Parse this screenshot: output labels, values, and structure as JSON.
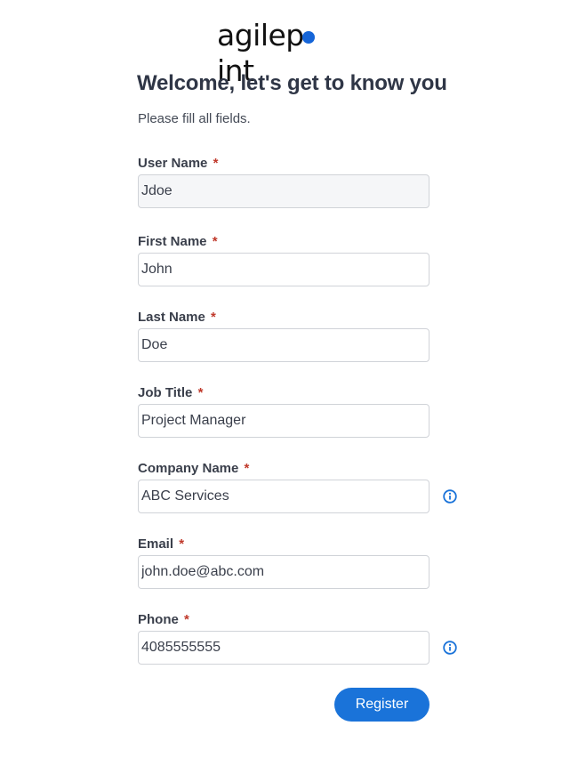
{
  "brand": {
    "logo_text_before": "agilep",
    "logo_text_after": "int",
    "accent_color": "#1a73d9"
  },
  "header": {
    "title": "Welcome, let's get to know you",
    "subtitle": "Please fill all fields."
  },
  "form": {
    "required_marker": "*",
    "fields": [
      {
        "label": "User Name",
        "value": "Jdoe",
        "readonly": true,
        "info": false
      },
      {
        "label": "First Name",
        "value": "John",
        "readonly": false,
        "info": false
      },
      {
        "label": "Last Name",
        "value": "Doe",
        "readonly": false,
        "info": false
      },
      {
        "label": "Job Title",
        "value": "Project Manager",
        "readonly": false,
        "info": false
      },
      {
        "label": "Company Name",
        "value": "ABC Services",
        "readonly": false,
        "info": true
      },
      {
        "label": "Email",
        "value": "john.doe@abc.com",
        "readonly": false,
        "info": false
      },
      {
        "label": "Phone",
        "value": "4085555555",
        "readonly": false,
        "info": true
      }
    ],
    "submit_label": "Register"
  },
  "icons": {
    "info": "info-circle-icon"
  }
}
